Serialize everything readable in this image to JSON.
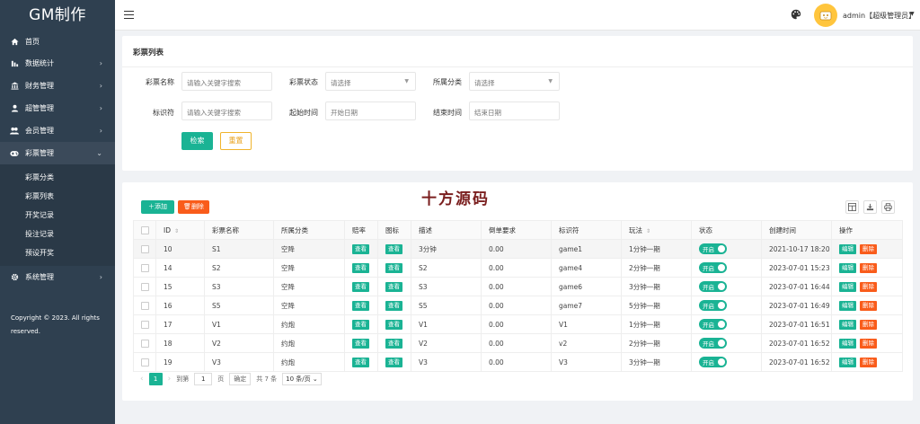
{
  "sidebar": {
    "brand": "GM制作",
    "items": [
      {
        "label": "首页",
        "icon": "home-icon"
      },
      {
        "label": "数据统计",
        "icon": "bar-chart-icon"
      },
      {
        "label": "财务管理",
        "icon": "bank-icon"
      },
      {
        "label": "超管管理",
        "icon": "user-icon"
      },
      {
        "label": "会员管理",
        "icon": "users-icon"
      },
      {
        "label": "彩票管理",
        "icon": "gamepad-icon"
      },
      {
        "label": "系统管理",
        "icon": "gear-icon"
      }
    ],
    "subitems": [
      "彩票分类",
      "彩票列表",
      "开奖记录",
      "投注记录",
      "预设开奖"
    ],
    "copyright": "Copyright © 2023. All rights reserved."
  },
  "topbar": {
    "user_label": "admin【超级管理员】"
  },
  "search": {
    "title": "彩票列表",
    "name_label": "彩票名称",
    "name_placeholder": "请输入关键字搜索",
    "status_label": "彩票状态",
    "status_placeholder": "请选择",
    "category_label": "所属分类",
    "category_placeholder": "请选择",
    "code_label": "标识符",
    "code_placeholder": "请输入关键字搜索",
    "start_label": "起始时间",
    "start_placeholder": "开始日期",
    "end_label": "结束时间",
    "end_placeholder": "结束日期",
    "search_btn": "检索",
    "reset_btn": "重置"
  },
  "table_panel": {
    "watermark": "十方源码",
    "add_btn": "添加",
    "delete_btn": "删除",
    "headers": [
      "ID",
      "彩票名称",
      "所属分类",
      "赔率",
      "图标",
      "描述",
      "倒单要求",
      "标识符",
      "玩法",
      "状态",
      "创建时间",
      "操作"
    ],
    "view_label": "查看",
    "switch_label": "开启",
    "edit_label": "编辑",
    "del_label": "删除",
    "rows": [
      {
        "id": "10",
        "name": "S1",
        "category": "空降",
        "desc": "3分钟",
        "req": "0.00",
        "code": "game1",
        "play": "1分钟一期",
        "created": "2021-10-17 18:20"
      },
      {
        "id": "14",
        "name": "S2",
        "category": "空降",
        "desc": "S2",
        "req": "0.00",
        "code": "game4",
        "play": "2分钟一期",
        "created": "2023-07-01 15:23"
      },
      {
        "id": "15",
        "name": "S3",
        "category": "空降",
        "desc": "S3",
        "req": "0.00",
        "code": "game6",
        "play": "3分钟一期",
        "created": "2023-07-01 16:44"
      },
      {
        "id": "16",
        "name": "S5",
        "category": "空降",
        "desc": "S5",
        "req": "0.00",
        "code": "game7",
        "play": "5分钟一期",
        "created": "2023-07-01 16:49"
      },
      {
        "id": "17",
        "name": "V1",
        "category": "约炮",
        "desc": "V1",
        "req": "0.00",
        "code": "V1",
        "play": "1分钟一期",
        "created": "2023-07-01 16:51"
      },
      {
        "id": "18",
        "name": "V2",
        "category": "约炮",
        "desc": "V2",
        "req": "0.00",
        "code": "v2",
        "play": "2分钟一期",
        "created": "2023-07-01 16:52"
      },
      {
        "id": "19",
        "name": "V3",
        "category": "约炮",
        "desc": "V3",
        "req": "0.00",
        "code": "V3",
        "play": "3分钟一期",
        "created": "2023-07-01 16:52"
      }
    ]
  },
  "pager": {
    "current": "1",
    "goto_label": "到第",
    "page_input": "1",
    "page_unit": "页",
    "confirm": "确定",
    "total": "共 7 条",
    "page_size": "10 条/页"
  },
  "colors": {
    "sidebar_bg": "#2f4050",
    "primary": "#1ab394",
    "danger": "#f95c1b",
    "warning": "#f0b42d"
  }
}
